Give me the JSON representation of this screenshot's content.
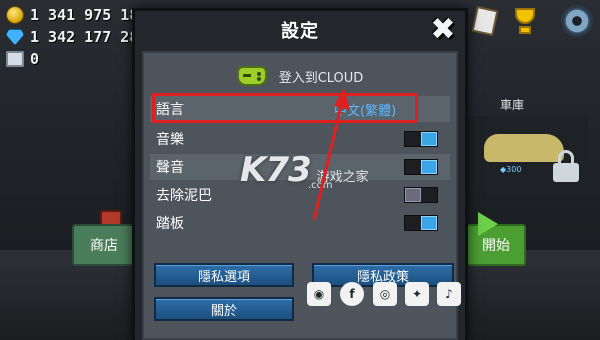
{
  "resources": {
    "coins": "1 341 975 189",
    "gems": "1 342 177 284",
    "fuel": "0"
  },
  "background": {
    "garage_label": "車庫",
    "car_price": "300",
    "shop_label": "商店",
    "start_label": "開始"
  },
  "dialog": {
    "title": "設定",
    "cloud_login": "登入到CLOUD",
    "settings": [
      {
        "label": "語言",
        "value": "中文(繁體)"
      },
      {
        "label": "音樂",
        "toggle": "on"
      },
      {
        "label": "聲音",
        "toggle": "on"
      },
      {
        "label": "去除泥巴",
        "toggle": "off"
      },
      {
        "label": "踏板",
        "toggle": "on"
      }
    ],
    "buttons": {
      "privacy_options": "隱私選項",
      "privacy_policy": "隱私政策",
      "about": "關於"
    },
    "social_icons": [
      "discord-icon",
      "facebook-icon",
      "instagram-icon",
      "twitter-icon",
      "tiktok-icon"
    ]
  },
  "watermark": {
    "brand": "K73",
    "site_cn": "游戏之家",
    "dot_com": ".com"
  },
  "colors": {
    "accent_blue": "#3aa6e8",
    "language_value": "#5ab9ff",
    "highlight_red": "#e02020",
    "button_blue": "#2d6fa8"
  }
}
